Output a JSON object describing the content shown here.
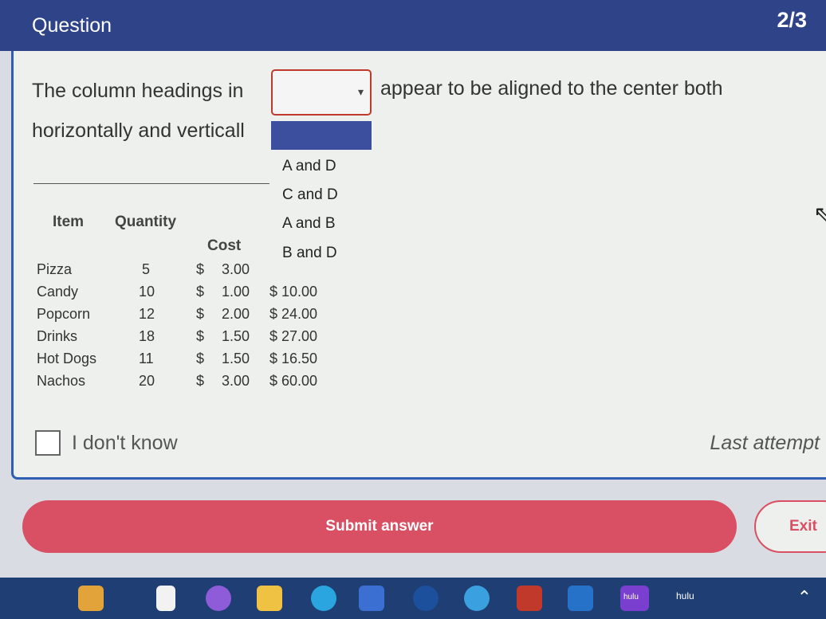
{
  "header": {
    "title": "Question",
    "progress": "2/3"
  },
  "prompt": {
    "before": "The column headings in",
    "after": "appear to be aligned to the center both",
    "line2": "horizontally and verticall"
  },
  "dropdown": {
    "selected": "",
    "options": [
      "A and D",
      "C and D",
      "A and B",
      "B and D"
    ]
  },
  "sheet": {
    "headers": {
      "item": "Item",
      "quantity": "Quantity",
      "cost": "Cost"
    },
    "rows": [
      {
        "item": "Pizza",
        "qty": "5",
        "cur": "$",
        "cost": "3.00",
        "total": ""
      },
      {
        "item": "Candy",
        "qty": "10",
        "cur": "$",
        "cost": "1.00",
        "total": "$ 10.00"
      },
      {
        "item": "Popcorn",
        "qty": "12",
        "cur": "$",
        "cost": "2.00",
        "total": "$ 24.00"
      },
      {
        "item": "Drinks",
        "qty": "18",
        "cur": "$",
        "cost": "1.50",
        "total": "$ 27.00"
      },
      {
        "item": "Hot Dogs",
        "qty": "11",
        "cur": "$",
        "cost": "1.50",
        "total": "$ 16.50"
      },
      {
        "item": "Nachos",
        "qty": "20",
        "cur": "$",
        "cost": "3.00",
        "total": "$ 60.00"
      }
    ]
  },
  "footer": {
    "idk": "I don't know",
    "last_attempt": "Last attempt"
  },
  "actions": {
    "submit": "Submit answer",
    "exit": "Exit"
  },
  "taskbar": {
    "app1": "hulu",
    "app2": "hulu"
  },
  "colors": {
    "header": "#2f4488",
    "accent": "#d94f63",
    "border": "#2f5fb3"
  }
}
